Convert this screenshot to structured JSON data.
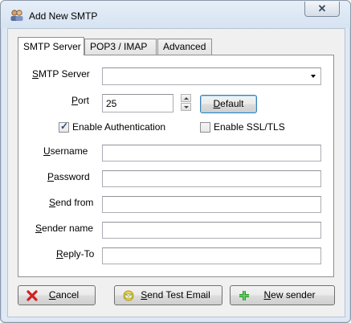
{
  "window": {
    "title": "Add New SMTP",
    "close_symbol": "✕"
  },
  "tabs": [
    {
      "label": "SMTP Server",
      "active": true
    },
    {
      "label": "POP3 / IMAP",
      "active": false
    },
    {
      "label": "Advanced",
      "active": false
    }
  ],
  "form": {
    "smtp_server": {
      "label": "SMTP Server",
      "value": ""
    },
    "port": {
      "label": "Port",
      "value": "25"
    },
    "default_button": "Default",
    "enable_auth": {
      "label": "Enable Authentication",
      "checked": true
    },
    "enable_ssl": {
      "label": "Enable SSL/TLS",
      "checked": false
    },
    "username": {
      "label": "Username",
      "value": ""
    },
    "password": {
      "label": "Password",
      "value": ""
    },
    "send_from": {
      "label": "Send from",
      "value": ""
    },
    "sender_name": {
      "label": "Sender name",
      "value": ""
    },
    "reply_to": {
      "label": "Reply-To",
      "value": ""
    }
  },
  "buttons": {
    "cancel": "Cancel",
    "send_test": "Send Test Email",
    "new_sender": "New sender"
  },
  "icons": {
    "app": "users-icon",
    "cancel": "red-x-icon",
    "send_test": "email-test-icon",
    "new_sender": "green-plus-icon"
  }
}
